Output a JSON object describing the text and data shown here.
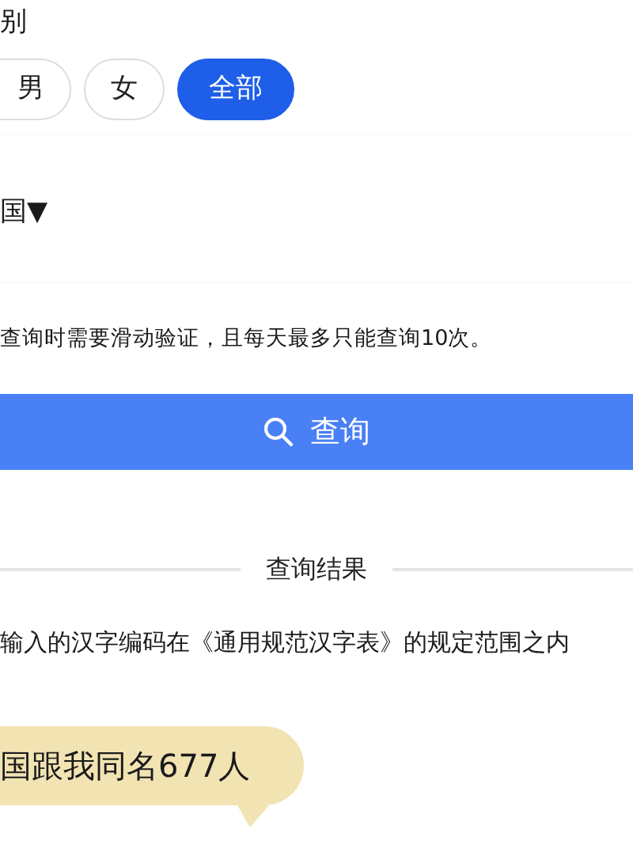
{
  "gender": {
    "label": "别",
    "options": [
      {
        "label": "男",
        "selected": false
      },
      {
        "label": "女",
        "selected": false
      },
      {
        "label": "全部",
        "selected": true
      }
    ]
  },
  "region": {
    "value": "国",
    "caret": "▼"
  },
  "notice": "查询时需要滑动验证，且每天最多只能查询10次。",
  "search_button": {
    "label": "查询"
  },
  "results": {
    "heading": "查询结果",
    "message": "输入的汉字编码在《通用规范汉字表》的规定范围之内",
    "bubble": "国跟我同名677人"
  }
}
